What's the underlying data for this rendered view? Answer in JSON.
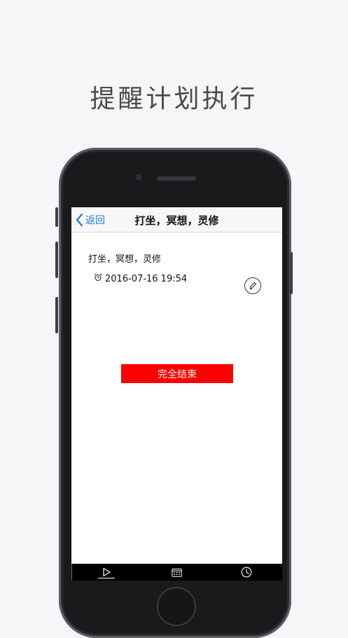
{
  "headline": "提醒计划执行",
  "navbar": {
    "back_label": "返回",
    "title": "打坐，冥想，灵修"
  },
  "task": {
    "title": "打坐，冥想，灵修",
    "reminder_time": "2016-07-16 19:54"
  },
  "actions": {
    "finish_label": "完全结束"
  },
  "tabbar": {
    "tabs": [
      {
        "icon": "play-icon",
        "active": true
      },
      {
        "icon": "calendar-icon",
        "active": false
      },
      {
        "icon": "clock-icon",
        "active": false
      }
    ]
  },
  "colors": {
    "accent": "#1f7de0",
    "finish_button": "#fe0000",
    "phone_body": "#1a1a1c"
  }
}
